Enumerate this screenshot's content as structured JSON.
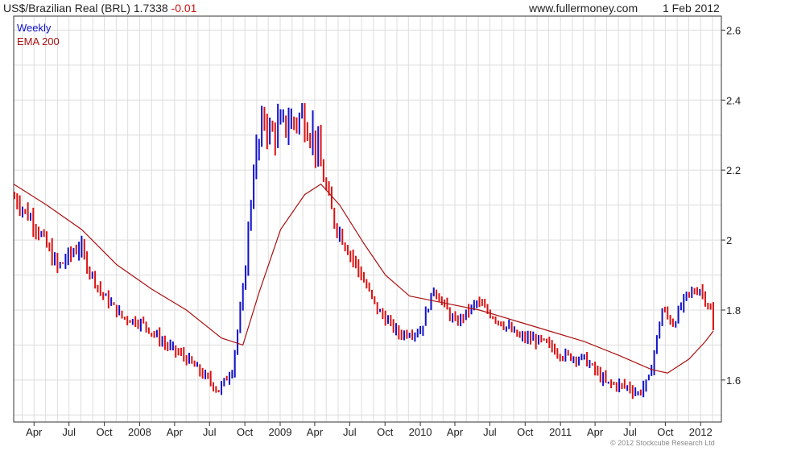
{
  "header": {
    "title": "US$/Brazilian Real (BRL) 1.7338",
    "change": "-0.01",
    "site": "www.fullermoney.com",
    "date": "1 Feb 2012"
  },
  "copyright": "© 2012 Stockcube Research Ltd",
  "colors": {
    "up_bar": "#1111cc",
    "down_bar": "#dd1111",
    "ema": "#aa1111",
    "grid": "#dddddd",
    "frame": "#333333",
    "legend_weekly": "#1111cc",
    "legend_ema": "#aa1111"
  },
  "chart_data": {
    "type": "line",
    "legend": [
      "Weekly",
      "EMA 200"
    ],
    "legend_position": "top-left",
    "grid": true,
    "y_axis_side": "right",
    "ylim": [
      1.48,
      2.64
    ],
    "y_ticks": [
      "1.6",
      "1.8",
      "2",
      "2.2",
      "2.4",
      "2.6"
    ],
    "x_ticks": [
      "Apr",
      "Jul",
      "Oct",
      "2008",
      "Apr",
      "Jul",
      "Oct",
      "2009",
      "Apr",
      "Jul",
      "Oct",
      "2010",
      "Apr",
      "Jul",
      "Oct",
      "2011",
      "Apr",
      "Jul",
      "Oct",
      "2012"
    ],
    "x_range": [
      "2007-02-07",
      "2012-02-24"
    ],
    "series": [
      {
        "name": "Weekly",
        "type": "weekly_bars",
        "x": [
          "2007-02-09",
          "2007-04-06",
          "2007-06-01",
          "2007-07-27",
          "2007-09-21",
          "2007-11-16",
          "2008-01-11",
          "2008-03-07",
          "2008-05-02",
          "2008-06-27",
          "2008-07-25",
          "2008-08-29",
          "2008-09-26",
          "2008-10-24",
          "2008-11-21",
          "2008-12-05",
          "2009-01-02",
          "2009-02-27",
          "2009-03-27",
          "2009-05-22",
          "2009-07-17",
          "2009-09-11",
          "2009-11-06",
          "2010-01-01",
          "2010-02-05",
          "2010-04-02",
          "2010-05-28",
          "2010-07-23",
          "2010-09-17",
          "2010-11-12",
          "2011-01-07",
          "2011-03-04",
          "2011-04-29",
          "2011-06-24",
          "2011-07-22",
          "2011-08-19",
          "2011-09-23",
          "2011-10-21",
          "2011-11-25",
          "2011-12-30",
          "2012-01-27",
          "2012-02-03"
        ],
        "values": [
          2.12,
          2.04,
          1.92,
          1.98,
          1.85,
          1.78,
          1.76,
          1.7,
          1.66,
          1.6,
          1.57,
          1.63,
          1.85,
          2.2,
          2.35,
          2.3,
          2.32,
          2.35,
          2.3,
          2.05,
          1.93,
          1.8,
          1.73,
          1.74,
          1.86,
          1.76,
          1.82,
          1.77,
          1.72,
          1.71,
          1.67,
          1.66,
          1.59,
          1.58,
          1.56,
          1.6,
          1.8,
          1.76,
          1.84,
          1.86,
          1.8,
          1.74
        ]
      },
      {
        "name": "EMA 200",
        "type": "line",
        "x": [
          "2007-02-07",
          "2007-05-04",
          "2007-08-03",
          "2007-11-02",
          "2008-02-01",
          "2008-05-02",
          "2008-08-01",
          "2008-09-26",
          "2008-11-07",
          "2009-01-02",
          "2009-03-06",
          "2009-04-17",
          "2009-06-05",
          "2009-08-07",
          "2009-10-02",
          "2009-12-04",
          "2010-03-05",
          "2010-06-04",
          "2010-09-03",
          "2010-12-03",
          "2011-03-04",
          "2011-06-03",
          "2011-08-26",
          "2011-10-07",
          "2011-12-02",
          "2012-01-13",
          "2012-02-03"
        ],
        "values": [
          2.16,
          2.1,
          2.03,
          1.93,
          1.86,
          1.8,
          1.72,
          1.7,
          1.85,
          2.03,
          2.13,
          2.16,
          2.1,
          1.99,
          1.9,
          1.84,
          1.82,
          1.8,
          1.77,
          1.74,
          1.71,
          1.67,
          1.63,
          1.62,
          1.66,
          1.71,
          1.74
        ]
      }
    ]
  }
}
